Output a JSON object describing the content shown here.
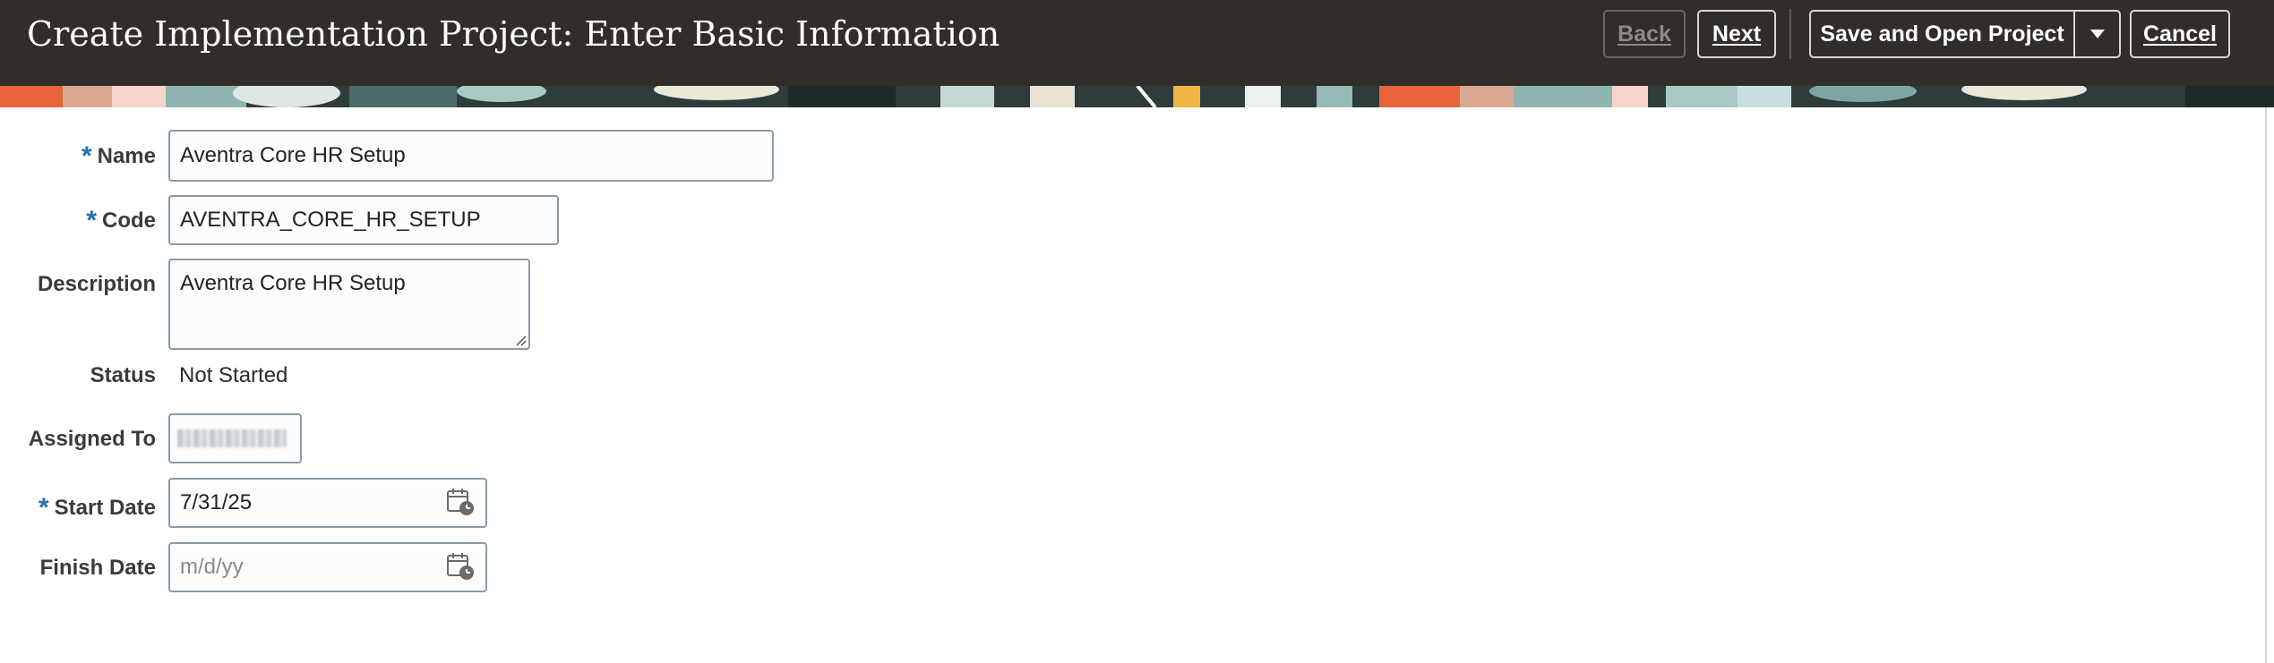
{
  "header": {
    "title": "Create Implementation Project: Enter Basic Information",
    "buttons": {
      "back": "Back",
      "next": "Next",
      "save_open": "Save and Open Project",
      "cancel": "Cancel"
    }
  },
  "form": {
    "required_mark": "*",
    "name": {
      "label": "Name",
      "value": "Aventra Core HR Setup"
    },
    "code": {
      "label": "Code",
      "value": "AVENTRA_CORE_HR_SETUP"
    },
    "description": {
      "label": "Description",
      "value": "Aventra Core HR Setup"
    },
    "status": {
      "label": "Status",
      "value": "Not Started"
    },
    "assigned_to": {
      "label": "Assigned To"
    },
    "start_date": {
      "label": "Start Date",
      "value": "7/31/25"
    },
    "finish_date": {
      "label": "Finish Date",
      "placeholder": "m/d/yy"
    }
  },
  "icons": {
    "calendar": "calendar-icon",
    "dropdown": "chevron-down-icon"
  },
  "colors": {
    "header_bg": "#312d2a",
    "required": "#1f6fb2",
    "field_border": "#8c9aa6"
  }
}
